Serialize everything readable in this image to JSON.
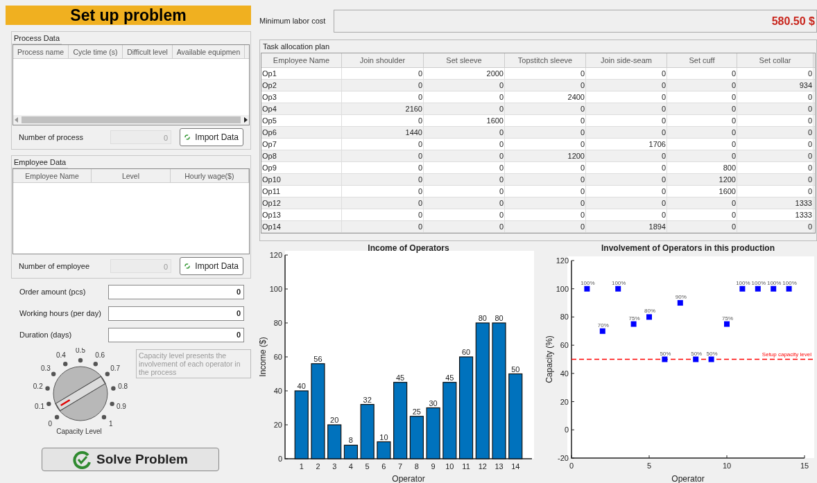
{
  "header": {
    "title": "Set up problem"
  },
  "process_data": {
    "title": "Process Data",
    "columns": [
      "Process name",
      "Cycle time (s)",
      "Difficult level",
      "Available equipmen"
    ],
    "count_label": "Number of process",
    "count": "0",
    "import_button": "Import Data"
  },
  "employee_data": {
    "title": "Employee Data",
    "columns": [
      "Employee Name",
      "Level",
      "Hourly wage($)"
    ],
    "count_label": "Number of employee",
    "count": "0",
    "import_button": "Import Data"
  },
  "inputs": [
    {
      "label": "Order amount (pcs)",
      "value": "0"
    },
    {
      "label": "Working hours (per day)",
      "value": "0"
    },
    {
      "label": "Duration (days)",
      "value": "0"
    }
  ],
  "capacity": {
    "scale": [
      "0",
      "0.1",
      "0.2",
      "0.3",
      "0.4",
      "0.5",
      "0.6",
      "0.7",
      "0.8",
      "0.9",
      "1"
    ],
    "title": "Capacity Level",
    "note": "Capacity level presents the involvement of each operator in the process"
  },
  "solve_button": "Solve Problem",
  "min_cost": {
    "label": "Minimum labor cost",
    "value": "580.50 $"
  },
  "task_plan": {
    "title": "Task allocation plan",
    "columns": [
      "Employee Name",
      "Join shoulder",
      "Set sleeve",
      "Topstitch sleeve",
      "Join side-seam",
      "Set cuff",
      "Set collar"
    ],
    "rows": [
      [
        "Op1",
        "0",
        "2000",
        "0",
        "0",
        "0",
        "0"
      ],
      [
        "Op2",
        "0",
        "0",
        "0",
        "0",
        "0",
        "934"
      ],
      [
        "Op3",
        "0",
        "0",
        "2400",
        "0",
        "0",
        "0"
      ],
      [
        "Op4",
        "2160",
        "0",
        "0",
        "0",
        "0",
        "0"
      ],
      [
        "Op5",
        "0",
        "1600",
        "0",
        "0",
        "0",
        "0"
      ],
      [
        "Op6",
        "1440",
        "0",
        "0",
        "0",
        "0",
        "0"
      ],
      [
        "Op7",
        "0",
        "0",
        "0",
        "1706",
        "0",
        "0"
      ],
      [
        "Op8",
        "0",
        "0",
        "1200",
        "0",
        "0",
        "0"
      ],
      [
        "Op9",
        "0",
        "0",
        "0",
        "0",
        "800",
        "0"
      ],
      [
        "Op10",
        "0",
        "0",
        "0",
        "0",
        "1200",
        "0"
      ],
      [
        "Op11",
        "0",
        "0",
        "0",
        "0",
        "1600",
        "0"
      ],
      [
        "Op12",
        "0",
        "0",
        "0",
        "0",
        "0",
        "1333"
      ],
      [
        "Op13",
        "0",
        "0",
        "0",
        "0",
        "0",
        "1333"
      ],
      [
        "Op14",
        "0",
        "0",
        "0",
        "1894",
        "0",
        "0"
      ]
    ]
  },
  "income_chart": {
    "chart_data": {
      "type": "bar",
      "title": "Income of Operators",
      "xlabel": "Operator",
      "ylabel": "Income ($)",
      "categories": [
        "1",
        "2",
        "3",
        "4",
        "5",
        "6",
        "7",
        "8",
        "9",
        "10",
        "11",
        "12",
        "13",
        "14"
      ],
      "series": [
        {
          "color": "#0072bd",
          "values": [
            40,
            56,
            20,
            8,
            32,
            10,
            45,
            25,
            30,
            45,
            60,
            80,
            80,
            50
          ]
        }
      ],
      "ylim": [
        0,
        120
      ],
      "yticks": [
        0,
        20,
        40,
        60,
        80,
        100,
        120
      ],
      "data_labels": true
    }
  },
  "involvement_chart": {
    "chart_data": {
      "type": "scatter",
      "title": "Involvement  of Operators in this production",
      "xlabel": "Operator",
      "ylabel": "Capacity (%)",
      "x": [
        1,
        2,
        3,
        4,
        5,
        6,
        7,
        8,
        9,
        10,
        11,
        12,
        13,
        14
      ],
      "series": [
        {
          "color": "#0000ff",
          "values": [
            100,
            70,
            100,
            75,
            80,
            50,
            90,
            50,
            50,
            75,
            100,
            100,
            100,
            100
          ]
        }
      ],
      "value_labels": [
        "100%",
        "70%",
        "100%",
        "75%",
        "80%",
        "50%",
        "90%",
        "50%",
        "50%",
        "75%",
        "100%",
        "100%",
        "100%",
        "100%"
      ],
      "xlim": [
        0,
        15
      ],
      "ylim": [
        -20,
        120
      ],
      "xticks": [
        0,
        5,
        10,
        15
      ],
      "yticks": [
        -20,
        0,
        20,
        40,
        60,
        80,
        100,
        120
      ],
      "ref_lines": [
        {
          "axis": "y",
          "value": 50,
          "label": "Setup capacity level",
          "color": "#ff0000"
        }
      ]
    }
  }
}
